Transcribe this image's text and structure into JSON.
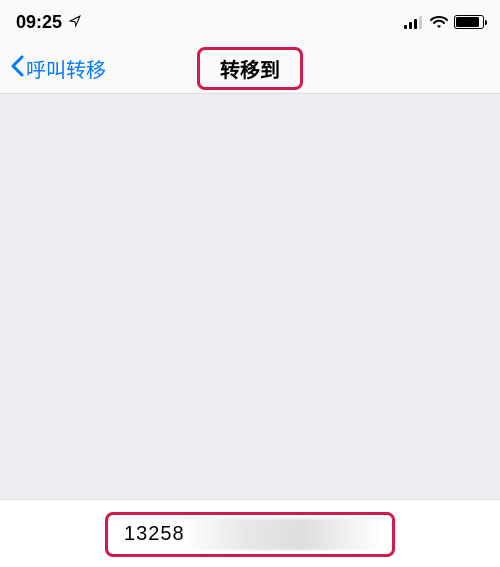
{
  "status_bar": {
    "time": "09:25"
  },
  "nav": {
    "back_label": "呼叫转移",
    "title": "转移到"
  },
  "input": {
    "value_visible": "13258"
  }
}
